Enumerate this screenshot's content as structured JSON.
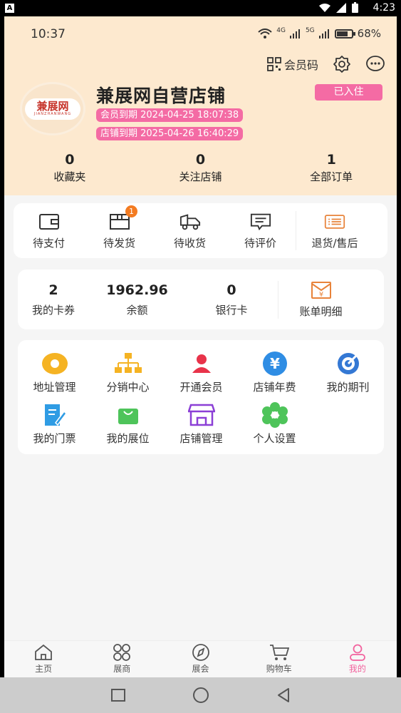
{
  "system_bar": {
    "time": "4:23",
    "app_indicator": "A"
  },
  "status": {
    "time": "10:37",
    "network_1": "4G",
    "network_2": "5G",
    "battery": "68%"
  },
  "top_actions": {
    "member_code_label": "会员码",
    "settings_icon": "gear-icon",
    "message_icon": "chat-icon"
  },
  "profile": {
    "logo_text": "兼展网",
    "logo_subtext": "JIANZHANWANG",
    "store_name": "兼展网自营店铺",
    "member_expiry": "会员到期 2024-04-25 18:07:38",
    "store_expiry": "店铺到期 2025-04-26 16:40:29",
    "status_label": "已入住"
  },
  "stats": [
    {
      "value": "0",
      "label": "收藏夹"
    },
    {
      "value": "0",
      "label": "关注店铺"
    },
    {
      "value": "1",
      "label": "全部订单"
    }
  ],
  "orders": [
    {
      "label": "待支付",
      "icon": "wallet-icon"
    },
    {
      "label": "待发货",
      "icon": "box-icon",
      "badge": "1"
    },
    {
      "label": "待收货",
      "icon": "truck-icon"
    },
    {
      "label": "待评价",
      "icon": "comment-icon"
    },
    {
      "label": "退货/售后",
      "icon": "return-list-icon"
    }
  ],
  "wallet": {
    "coupons": {
      "value": "2",
      "label": "我的卡券"
    },
    "balance": {
      "value": "1962.96",
      "label": "余额"
    },
    "bank_cards": {
      "value": "0",
      "label": "银行卡"
    },
    "bill": {
      "label": "账单明细",
      "icon": "bill-icon"
    }
  },
  "services": [
    {
      "label": "地址管理",
      "icon": "location-icon"
    },
    {
      "label": "分销中心",
      "icon": "hierarchy-icon"
    },
    {
      "label": "开通会员",
      "icon": "user-icon"
    },
    {
      "label": "店铺年费",
      "icon": "yen-icon"
    },
    {
      "label": "我的期刊",
      "icon": "target-icon"
    },
    {
      "label": "我的门票",
      "icon": "ticket-edit-icon"
    },
    {
      "label": "我的展位",
      "icon": "bag-icon"
    },
    {
      "label": "店铺管理",
      "icon": "store-icon"
    },
    {
      "label": "个人设置",
      "icon": "flower-gear-icon"
    }
  ],
  "tabs": [
    {
      "label": "主页",
      "icon": "home-icon"
    },
    {
      "label": "展商",
      "icon": "grid-icon"
    },
    {
      "label": "展会",
      "icon": "compass-icon"
    },
    {
      "label": "购物车",
      "icon": "cart-icon"
    },
    {
      "label": "我的",
      "icon": "person-icon",
      "active": true
    }
  ],
  "colors": {
    "header_bg": "#fde9cf",
    "accent_pink": "#f46ba4",
    "badge_orange": "#f37b21",
    "active_tab": "#f2639e"
  }
}
